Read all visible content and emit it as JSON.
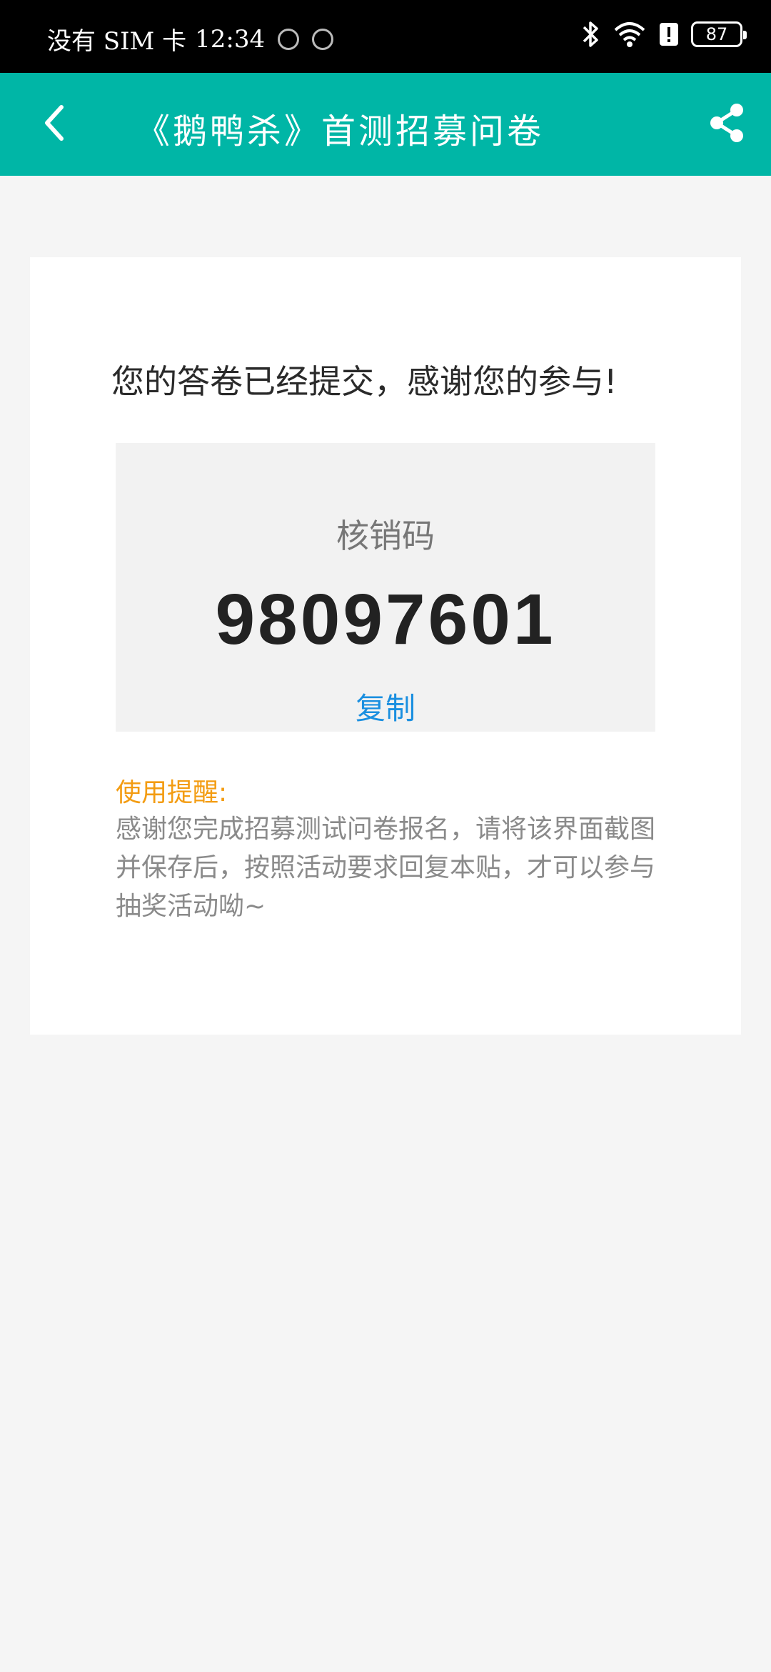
{
  "status_bar": {
    "carrier": "没有 SIM 卡",
    "time": "12:34",
    "battery": "87"
  },
  "app_bar": {
    "title": "《鹅鸭杀》首测招募问卷",
    "back_icon": "chevron-left-icon",
    "share_icon": "share-icon",
    "color": "#00b6a6"
  },
  "card": {
    "success_message": "您的答卷已经提交，感谢您的参与!",
    "code": {
      "label": "核销码",
      "value": "98097601",
      "copy_label": "复制"
    },
    "reminder": {
      "title": "使用提醒:",
      "text": "感谢您完成招募测试问卷报名，请将该界面截图并保存后，按照活动要求回复本贴，才可以参与抽奖活动呦~"
    }
  },
  "colors": {
    "accent": "#00b6a6",
    "link": "#1a8fe0",
    "warning": "#f39c12"
  }
}
